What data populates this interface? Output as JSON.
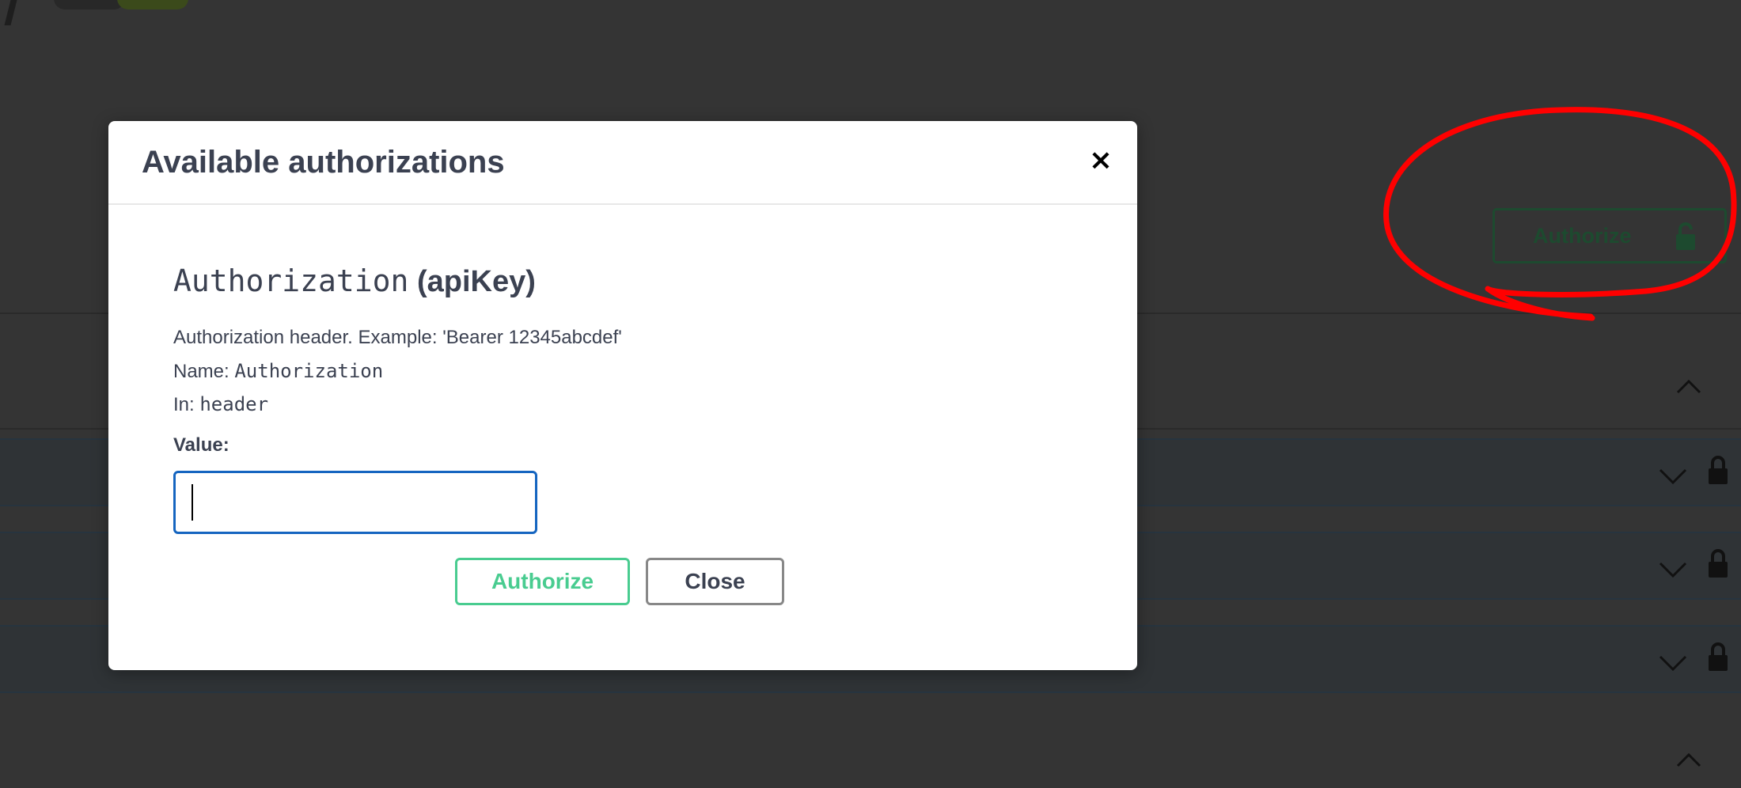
{
  "background": {
    "authorize_button_label": "Authorize",
    "operation_rows": [
      {
        "label": ""
      },
      {
        "label": ""
      },
      {
        "label": ""
      }
    ]
  },
  "modal": {
    "title": "Available authorizations",
    "close_icon": "×",
    "scheme": {
      "name": "Authorization",
      "type": "(apiKey)",
      "description": "Authorization header. Example: 'Bearer 12345abcdef'",
      "name_label": "Name:",
      "name_value": "Authorization",
      "in_label": "In:",
      "in_value": "header",
      "value_label": "Value:",
      "value_input": ""
    },
    "buttons": {
      "authorize": "Authorize",
      "close": "Close"
    }
  },
  "colors": {
    "backdrop": "#343434",
    "modal_bg": "#ffffff",
    "text": "#3b4151",
    "authorize_green": "#49cc90",
    "input_focus_blue": "#1565c0",
    "annotation_red": "#ff0000"
  },
  "icons": {
    "lock": "lock-icon",
    "chevron_up": "chevron-up-icon",
    "chevron_down": "chevron-down-icon",
    "close": "close-icon"
  }
}
